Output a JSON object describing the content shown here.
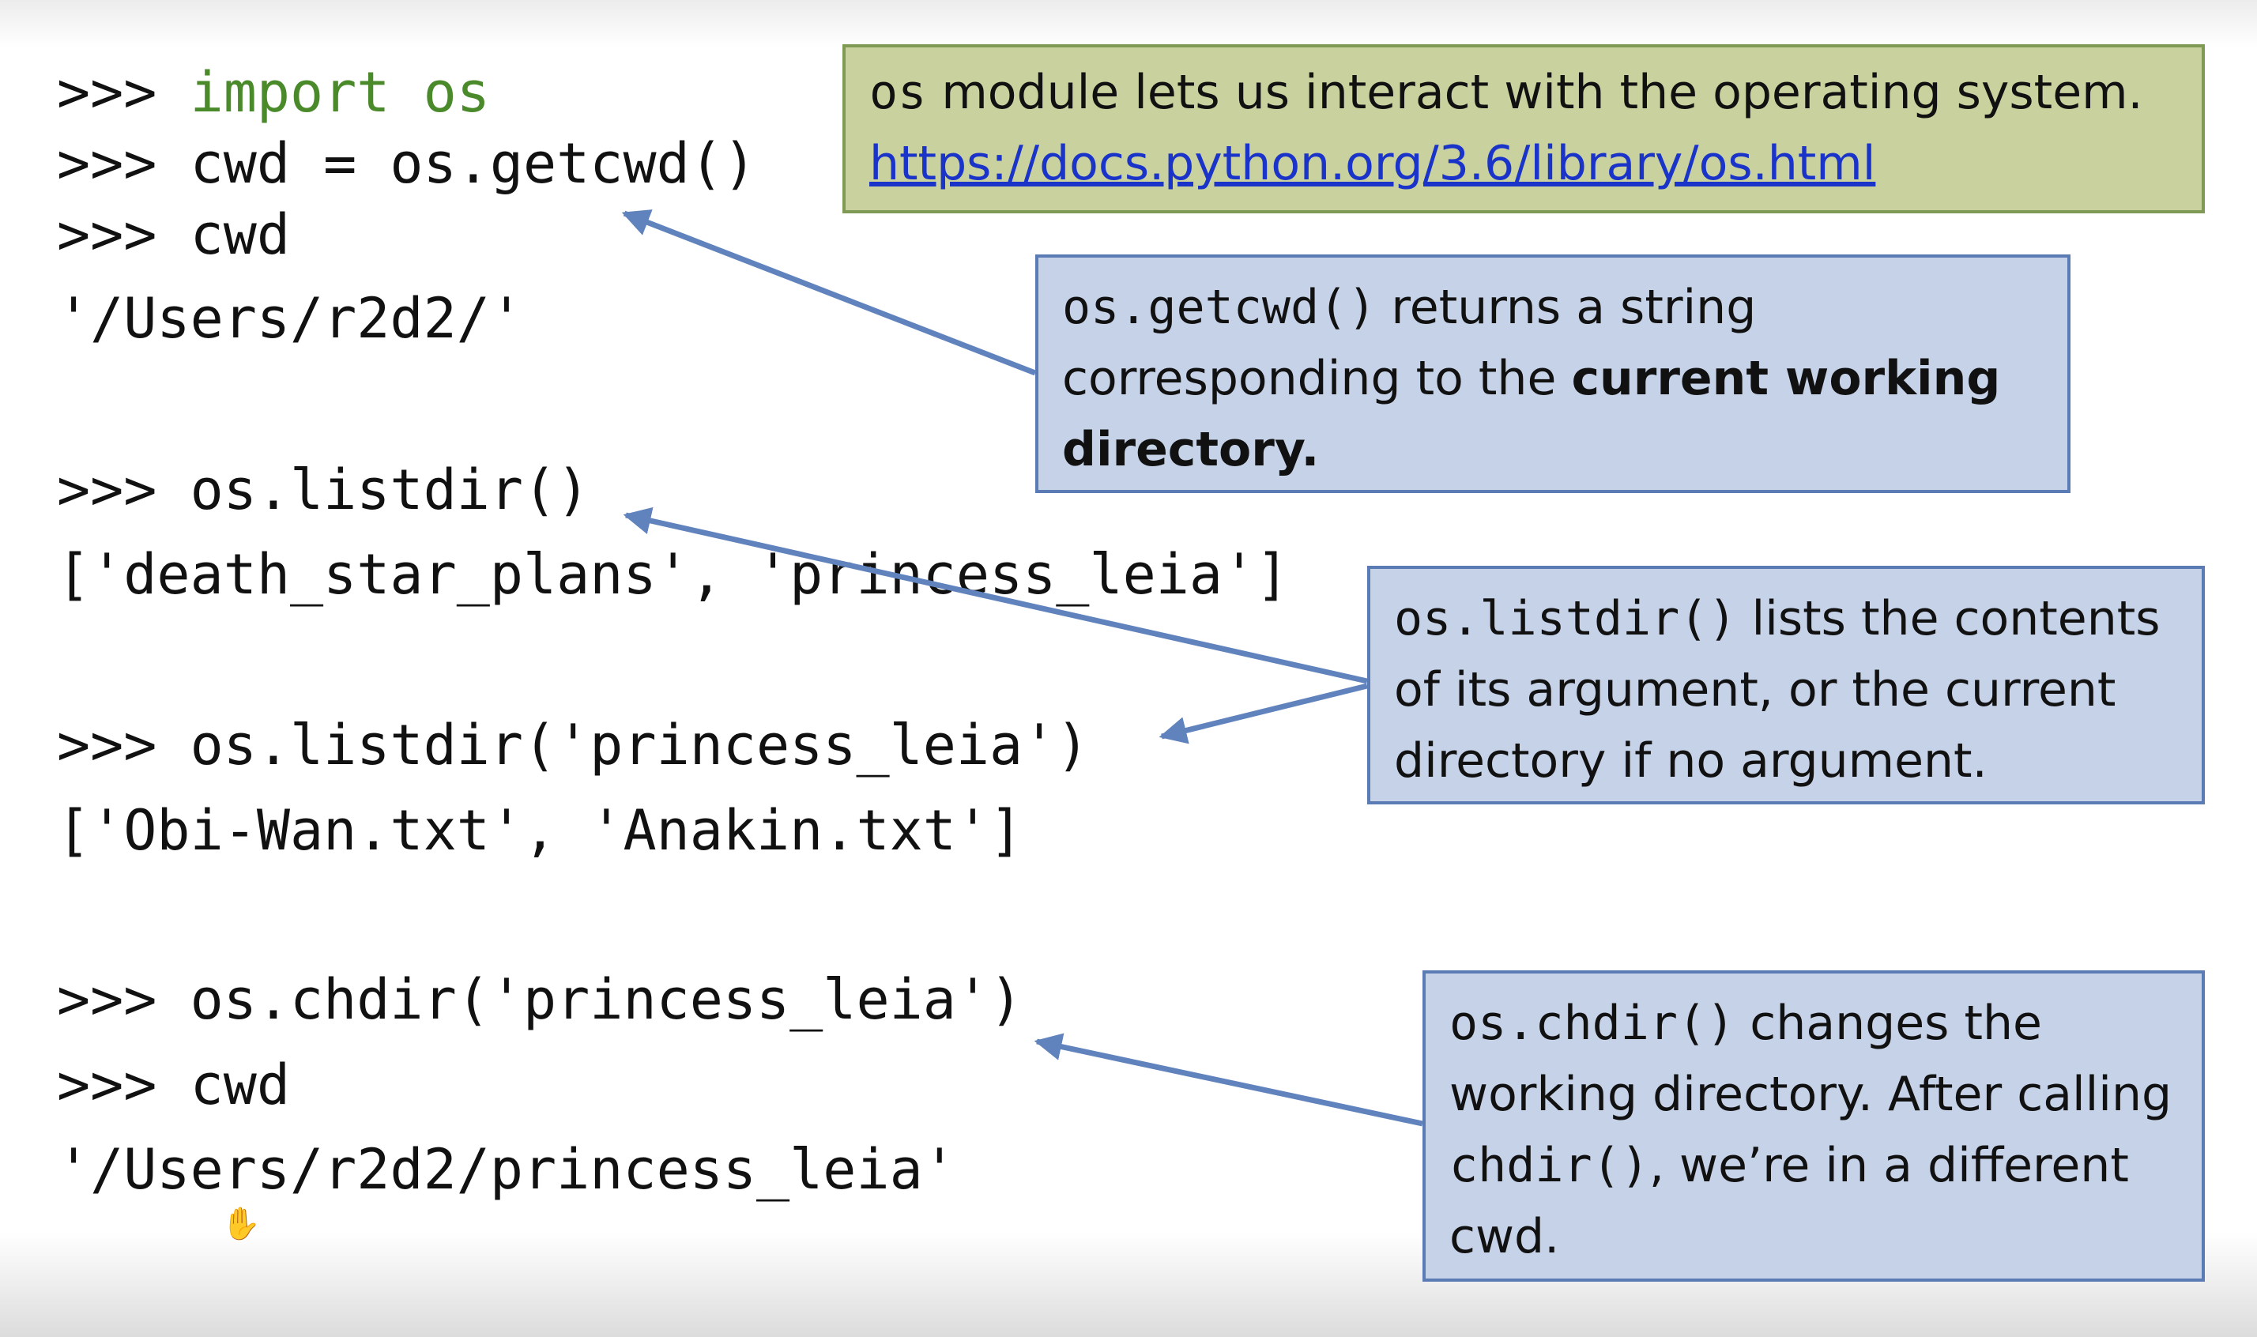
{
  "code_lines": {
    "l1_prompt": ">>> ",
    "l1_code": "import os",
    "l2": ">>> cwd = os.getcwd()",
    "l3": ">>> cwd",
    "l4": "'/Users/r2d2/'",
    "l5": ">>> os.listdir()",
    "l6": "['death_star_plans', 'princess_leia']",
    "l7": ">>> os.listdir('princess_leia')",
    "l8": "['Obi-Wan.txt', 'Anakin.txt']",
    "l9": ">>> os.chdir('princess_leia')",
    "l10": ">>> cwd",
    "l11": "'/Users/r2d2/princess_leia'"
  },
  "note_os": {
    "code": "os",
    "text": " module lets us interact with the operating system.",
    "link": "https://docs.python.org/3.6/library/os.html"
  },
  "note_getcwd": {
    "code": "os.getcwd()",
    "text1": " returns a string corresponding to the ",
    "bold": "current working directory."
  },
  "note_listdir": {
    "code": "os.listdir()",
    "text": " lists the contents of its argument, or the current directory if no argument."
  },
  "note_chdir": {
    "code": "os.chdir()",
    "text1": " changes the working directory. After calling ",
    "code2": "chdir()",
    "text2": ", we’re in a different cwd."
  },
  "colors": {
    "keyword": "#4a8a2a",
    "green_box": "#c9d29e",
    "blue_box": "#c6d2e7",
    "arrow": "#6183bd",
    "link": "#1a33c8"
  },
  "icons": {
    "cursor": "hand-cursor-icon"
  }
}
